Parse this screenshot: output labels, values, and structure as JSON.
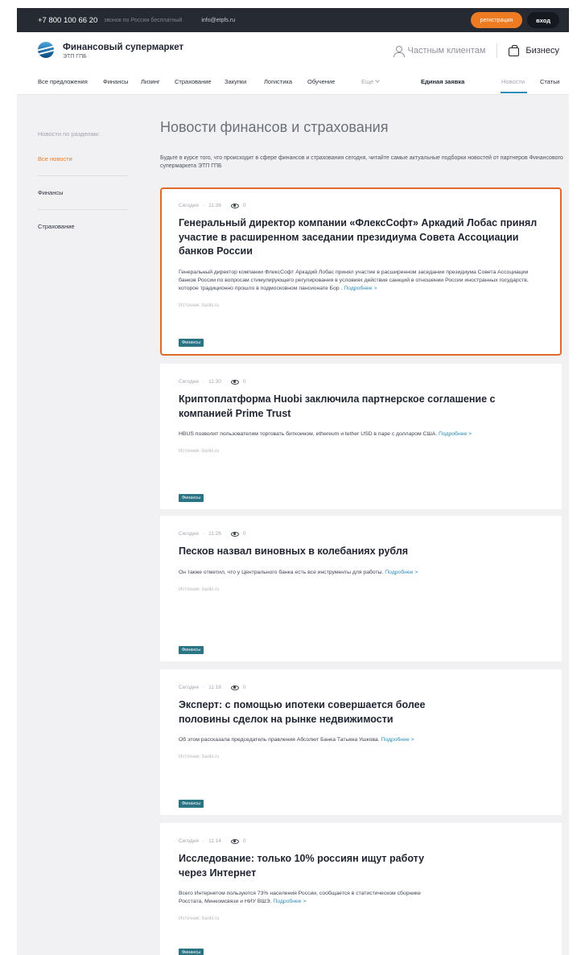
{
  "topbar": {
    "phone": "+7 800 100 66 20",
    "phone_note": "звонок по России бесплатный",
    "email": "info@etpfs.ru",
    "register_label": "регистрация",
    "login_label": "вход"
  },
  "header": {
    "brand_title": "Финансовый супермаркет",
    "brand_subtitle": "ЭТП ГПБ",
    "private_label": "Частным клиентам",
    "business_label": "Бизнесу"
  },
  "nav": {
    "items": [
      "Все предложения",
      "Финансы",
      "Лизинг",
      "Страхование",
      "Закупки",
      "Логистика",
      "Обучение"
    ],
    "more_label": "Еще",
    "single_request": "Единая заявка",
    "news": "Новости",
    "articles": "Статьи"
  },
  "sidebar": {
    "heading": "Новости по разделам:",
    "items": [
      "Все новости",
      "Финансы",
      "Страхование"
    ]
  },
  "main": {
    "title": "Новости финансов и страхования",
    "intro": "Будьте в курсе того, что происходит в сфере финансов и страхования сегодня, читайте самые актуальные подборки новостей от партнеров Финансового супермаркета ЭТП ГПБ"
  },
  "common": {
    "more": "Подробнее >",
    "source": "Источник: banki.ru",
    "tag": "Финансы",
    "day": "Сегодня"
  },
  "news": [
    {
      "time": "11:36",
      "views": "0",
      "title": "Генеральный директор компании «ФлексСофт» Аркадий Лобас принял участие в расширенном заседании президиума Совета Ассоциации банков России",
      "text": "Генеральный директор компании ФлексСофт Аркадий Лобас принял участие в расширенном заседании президиума Совета Ассоциации банков России по вопросам стимулирующего регулирования в условиях действия санкций в отношении России иностранных государств, которое традиционно прошло в подмосковном пансионате Бор ."
    },
    {
      "time": "11:30",
      "views": "0",
      "title": "Криптоплатформа Huobi заключила партнерское соглашение с компанией Prime Trust",
      "text": "HBUS позволит пользователям торговать биткоином, ethereum и tether USD в паре с долларом США."
    },
    {
      "time": "11:26",
      "views": "0",
      "title": "Песков назвал виновных в колебаниях рубля",
      "text": "Он также отметил, что у Центрального банка есть все инструменты для работы."
    },
    {
      "time": "11:18",
      "views": "0",
      "title": "Эксперт: с помощью ипотеки совершается более половины сделок на рынке недвижимости",
      "text": "Об этом рассказала председатель правления Абсолют Банка Татьяна Ушкова."
    },
    {
      "time": "11:14",
      "views": "0",
      "title": "Исследование: только 10% россиян ищут работу через Интернет",
      "text": "Всего Интернетом пользуются 73% населения России, сообщается в статистическом сборнике Росстата, Минкомсвязи и НИУ ВШЭ."
    }
  ],
  "colors": {
    "accent": "#ee7a22",
    "link": "#2a8cb8",
    "tag": "#2b7486",
    "topbar": "#262a33"
  }
}
